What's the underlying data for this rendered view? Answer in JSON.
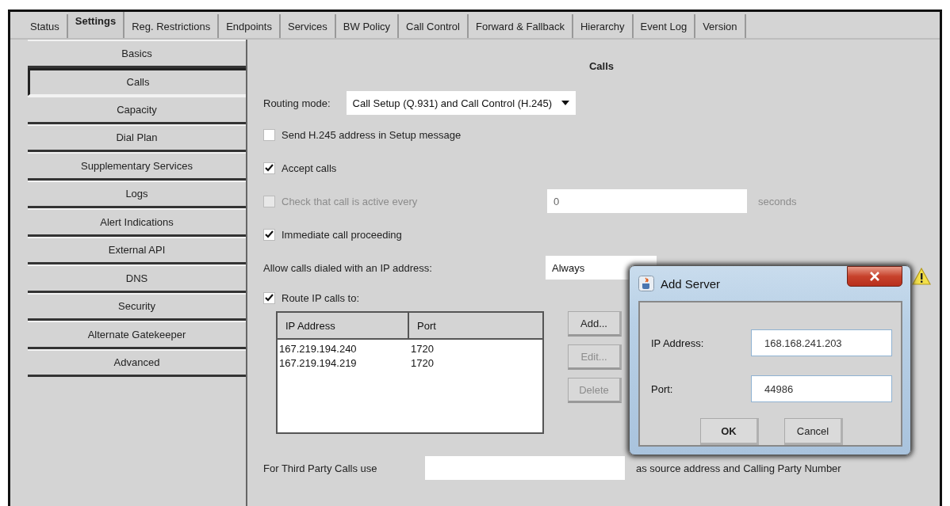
{
  "tabs": [
    {
      "label": "Status",
      "selected": false
    },
    {
      "label": "Settings",
      "selected": true
    },
    {
      "label": "Reg. Restrictions",
      "selected": false
    },
    {
      "label": "Endpoints",
      "selected": false
    },
    {
      "label": "Services",
      "selected": false
    },
    {
      "label": "BW Policy",
      "selected": false
    },
    {
      "label": "Call Control",
      "selected": false
    },
    {
      "label": "Forward & Fallback",
      "selected": false
    },
    {
      "label": "Hierarchy",
      "selected": false
    },
    {
      "label": "Event Log",
      "selected": false
    },
    {
      "label": "Version",
      "selected": false
    }
  ],
  "sidebar": {
    "items": [
      {
        "label": "Basics",
        "selected": false
      },
      {
        "label": "Calls",
        "selected": true
      },
      {
        "label": "Capacity",
        "selected": false
      },
      {
        "label": "Dial Plan",
        "selected": false
      },
      {
        "label": "Supplementary Services",
        "selected": false
      },
      {
        "label": "Logs",
        "selected": false
      },
      {
        "label": "Alert Indications",
        "selected": false
      },
      {
        "label": "External API",
        "selected": false
      },
      {
        "label": "DNS",
        "selected": false
      },
      {
        "label": "Security",
        "selected": false
      },
      {
        "label": "Alternate Gatekeeper",
        "selected": false
      },
      {
        "label": "Advanced",
        "selected": false
      }
    ]
  },
  "panel": {
    "title": "Calls",
    "routing_mode": {
      "label": "Routing mode:",
      "value": "Call Setup (Q.931) and Call Control (H.245)"
    },
    "send_h245": {
      "label": "Send H.245 address in Setup message",
      "checked": false
    },
    "accept_calls": {
      "label": "Accept calls",
      "checked": true
    },
    "check_active": {
      "label": "Check that call is active every",
      "checked": false,
      "disabled": true,
      "value": "0",
      "unit": "seconds"
    },
    "immediate": {
      "label": "Immediate call proceeding",
      "checked": true
    },
    "allow_ip": {
      "label": "Allow calls dialed with an IP address:",
      "value": "Always"
    },
    "route_ip": {
      "label": "Route IP calls to:",
      "checked": true
    },
    "servers": {
      "columns": [
        "IP Address",
        "Port"
      ],
      "rows": [
        [
          "167.219.194.240",
          "1720"
        ],
        [
          "167.219.194.219",
          "1720"
        ]
      ]
    },
    "server_buttons": [
      {
        "label": "Add...",
        "disabled": false
      },
      {
        "label": "Edit...",
        "disabled": true
      },
      {
        "label": "Delete",
        "disabled": true
      }
    ],
    "third_party": {
      "label": "For Third Party Calls use",
      "suffix": "as source address and Calling Party Number"
    }
  },
  "dialog": {
    "title": "Add Server",
    "fields": [
      {
        "label": "IP Address:",
        "value": "168.168.241.203"
      },
      {
        "label": "Port:",
        "value": "44986"
      }
    ],
    "buttons": [
      "OK",
      "Cancel"
    ]
  }
}
